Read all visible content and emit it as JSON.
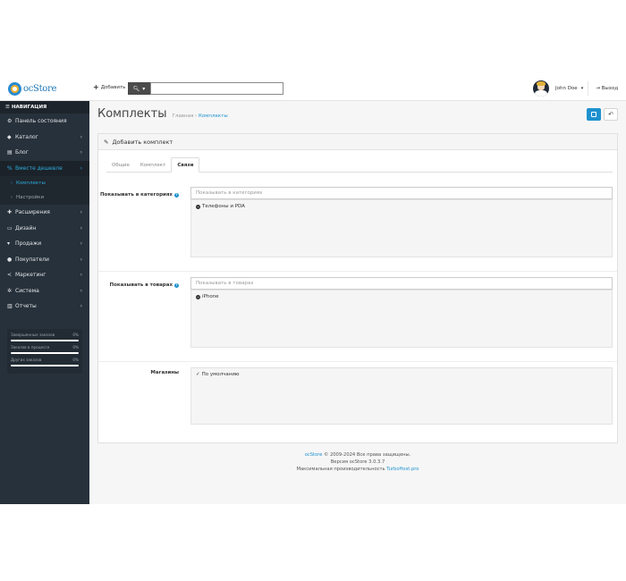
{
  "topbar": {
    "logo_text": "ocStore",
    "add_label": "Добавить",
    "search_placeholder": "",
    "user_name": "John Doe",
    "logout_label": "Выход"
  },
  "sidebar": {
    "header": "НАВИГАЦИЯ",
    "items": [
      {
        "label": "Панель состояния",
        "icon": "dashboard-icon",
        "glyph": "⚙",
        "arrow": false
      },
      {
        "label": "Каталог",
        "icon": "tag-icon",
        "glyph": "◆",
        "arrow": true
      },
      {
        "label": "Блог",
        "icon": "blog-icon",
        "glyph": "▤",
        "arrow": true
      },
      {
        "label": "Вместе дешевле",
        "icon": "percent-icon",
        "glyph": "%",
        "arrow": true,
        "active": true
      }
    ],
    "sub_items": [
      {
        "label": "Комплекты",
        "active": true
      },
      {
        "label": "Настройки",
        "active": false
      }
    ],
    "items_after": [
      {
        "label": "Расширения",
        "icon": "puzzle-icon",
        "glyph": "✚",
        "arrow": true
      },
      {
        "label": "Дизайн",
        "icon": "monitor-icon",
        "glyph": "▭",
        "arrow": true
      },
      {
        "label": "Продажи",
        "icon": "cart-icon",
        "glyph": "▾",
        "arrow": true
      },
      {
        "label": "Покупатели",
        "icon": "user-icon",
        "glyph": "●",
        "arrow": true
      },
      {
        "label": "Маркетинг",
        "icon": "share-icon",
        "glyph": "<",
        "arrow": true
      },
      {
        "label": "Система",
        "icon": "cog-icon",
        "glyph": "✲",
        "arrow": true
      },
      {
        "label": "Отчеты",
        "icon": "bar-chart-icon",
        "glyph": "▥",
        "arrow": true
      }
    ],
    "stats": [
      {
        "label": "Завершенных заказов",
        "percent": "0%"
      },
      {
        "label": "Заказов в процессе",
        "percent": "0%"
      },
      {
        "label": "Других заказов",
        "percent": "0%"
      }
    ]
  },
  "header": {
    "title": "Комплекты",
    "breadcrumb_home": "Главная",
    "breadcrumb_sep": "›",
    "breadcrumb_current": "Комплекты"
  },
  "panel": {
    "heading": "Добавить комплект",
    "tabs": [
      {
        "label": "Общие",
        "active": false
      },
      {
        "label": "Комплект",
        "active": false
      },
      {
        "label": "Связи",
        "active": true
      }
    ],
    "categories": {
      "label": "Показывать в категориях",
      "placeholder": "Показывать в категориях",
      "items": [
        "Телефоны и PDA"
      ]
    },
    "products": {
      "label": "Показывать в товарах",
      "placeholder": "Показывать в товарах",
      "items": [
        "iPhone"
      ]
    },
    "stores": {
      "label": "Магазины",
      "items": [
        {
          "label": "По умолчанию",
          "checked": true
        }
      ]
    }
  },
  "footer": {
    "brand_link": "ocStore",
    "line1_rest": " © 2009-2024 Все права защищены.",
    "line2": "Версия ocStore 3.0.3.7",
    "line3_text": "Максимальная производительность ",
    "line3_link": "TurboHost.pro"
  },
  "colors": {
    "accent": "#1e91cf",
    "sidebar_bg": "#27313b"
  }
}
